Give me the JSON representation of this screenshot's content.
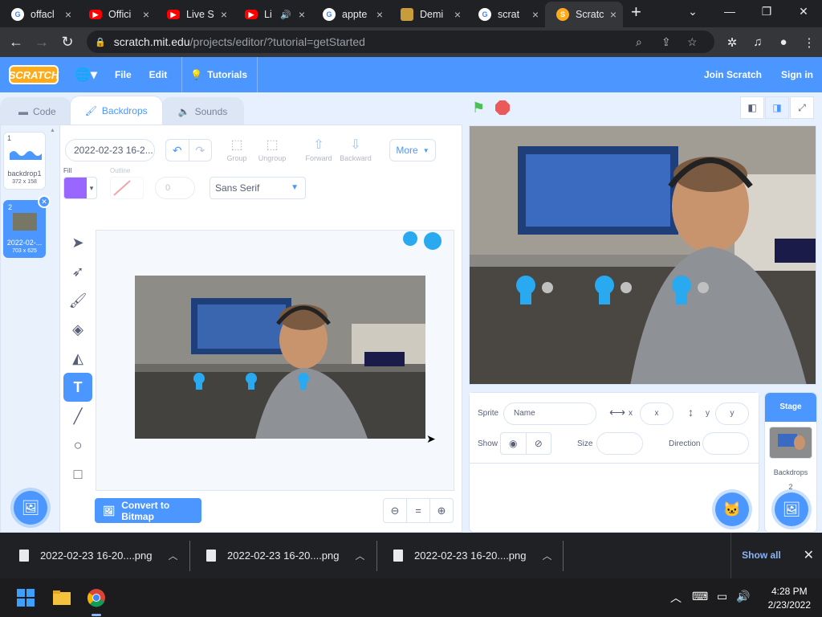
{
  "browser": {
    "tabs": [
      {
        "title": "offacl",
        "icon": "google-icon"
      },
      {
        "title": "Offici",
        "icon": "youtube-icon"
      },
      {
        "title": "Live S",
        "icon": "youtube-icon"
      },
      {
        "title": "Li",
        "icon": "youtube-icon"
      },
      {
        "title": "appte",
        "icon": "google-icon"
      },
      {
        "title": "Demi",
        "icon": "cube-icon"
      },
      {
        "title": "scrat",
        "icon": "google-icon"
      },
      {
        "title": "Scratc",
        "icon": "scratch-icon"
      }
    ],
    "url_host": "scratch.mit.edu",
    "url_path": "/projects/editor/?tutorial=getStarted"
  },
  "menubar": {
    "logo": "SCRATCH",
    "file": "File",
    "edit": "Edit",
    "tutorials": "Tutorials",
    "join": "Join Scratch",
    "signin": "Sign in"
  },
  "editor_tabs": {
    "code": "Code",
    "backdrops": "Backdrops",
    "sounds": "Sounds"
  },
  "backdrops": [
    {
      "num": "1",
      "name": "backdrop1",
      "size": "372 x 158"
    },
    {
      "num": "2",
      "name": "2022-02-...",
      "size": "703 x 625"
    }
  ],
  "paint": {
    "costume_name": "2022-02-23 16-2...",
    "group": "Group",
    "ungroup": "Ungroup",
    "forward": "Forward",
    "backward": "Backward",
    "more": "More",
    "fill_label": "Fill",
    "fill_color": "#9966ff",
    "outline_label": "Outline",
    "outline_width": "0",
    "font": "Sans Serif",
    "convert": "Convert to Bitmap",
    "zoom_equal": "="
  },
  "sprite_info": {
    "sprite_label": "Sprite",
    "name_placeholder": "Name",
    "x_label": "x",
    "x_placeholder": "x",
    "y_label": "y",
    "y_placeholder": "y",
    "show_label": "Show",
    "size_label": "Size",
    "direction_label": "Direction"
  },
  "stage_panel": {
    "header": "Stage",
    "backdrops_label": "Backdrops",
    "backdrops_count": "2"
  },
  "downloads": [
    {
      "name": "2022-02-23 16-20....png"
    },
    {
      "name": "2022-02-23 16-20....png"
    },
    {
      "name": "2022-02-23 16-20....png"
    }
  ],
  "show_all": "Show all",
  "clock": {
    "time": "4:28 PM",
    "date": "2/23/2022"
  }
}
